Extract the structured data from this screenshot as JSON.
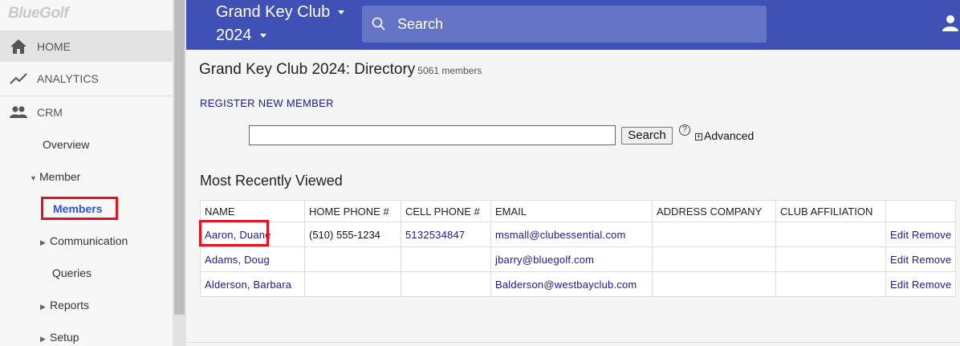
{
  "sidebar": {
    "logo": "BlueGolf",
    "nav": [
      {
        "label": "HOME",
        "icon": "home-icon"
      },
      {
        "label": "ANALYTICS",
        "icon": "analytics-icon"
      },
      {
        "label": "CRM",
        "icon": "people-icon"
      }
    ],
    "crm": {
      "overview": "Overview",
      "member": "Member",
      "members": "Members",
      "communication": "Communication",
      "queries": "Queries",
      "reports": "Reports",
      "setup": "Setup"
    }
  },
  "topbar": {
    "club_line1": "Grand Key Club",
    "club_line2": "2024",
    "search_label": "Search",
    "user_icon": "account-icon"
  },
  "main": {
    "title": "Grand Key Club 2024: Directory",
    "member_count": "5061 members",
    "register_link": "REGISTER NEW MEMBER",
    "search_button": "Search",
    "help": "?",
    "advanced": "Advanced",
    "recent_heading": "Most Recently Viewed",
    "columns": [
      "NAME",
      "HOME PHONE #",
      "CELL PHONE #",
      "EMAIL",
      "ADDRESS COMPANY",
      "CLUB AFFILIATION",
      ""
    ],
    "rows": [
      {
        "name": "Aaron, Duane",
        "home": "(510) 555-1234",
        "cell": "5132534847",
        "email": "msmall@clubessential.com",
        "company": "",
        "affiliation": "",
        "edit": "Edit",
        "remove": "Remove"
      },
      {
        "name": "Adams, Doug",
        "home": "",
        "cell": "",
        "email": "jbarry@bluegolf.com",
        "company": "",
        "affiliation": "",
        "edit": "Edit",
        "remove": "Remove"
      },
      {
        "name": "Alderson, Barbara",
        "home": "",
        "cell": "",
        "email": "Balderson@westbayclub.com",
        "company": "",
        "affiliation": "",
        "edit": "Edit",
        "remove": "Remove"
      }
    ]
  },
  "colors": {
    "topbar": "#3f51b5",
    "search_bg": "#6574c4",
    "highlight": "#e0141e",
    "link": "#1a1a8c"
  }
}
